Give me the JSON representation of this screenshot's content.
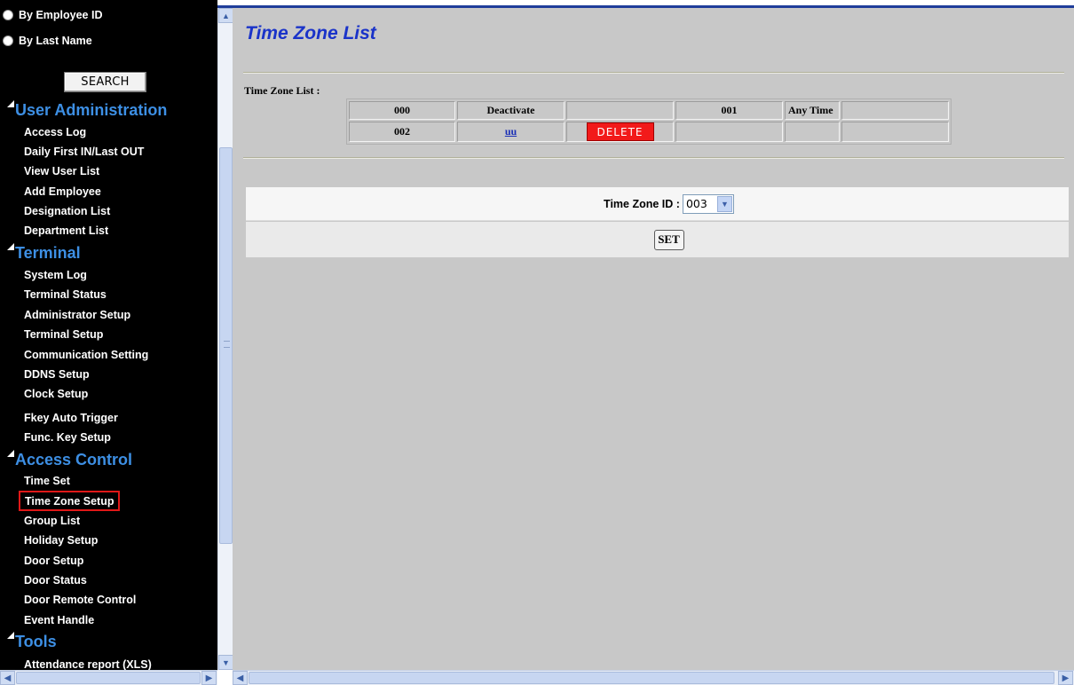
{
  "sidebar": {
    "search_options": [
      {
        "label": "By Employee ID"
      },
      {
        "label": "By Last Name"
      }
    ],
    "search_button": "SEARCH",
    "sections": [
      {
        "title": "User Administration",
        "items": [
          "Access Log",
          "Daily First IN/Last OUT",
          "View User List",
          "Add Employee",
          "Designation List",
          "Department List"
        ]
      },
      {
        "title": "Terminal",
        "items": [
          "System Log",
          "Terminal Status",
          "Administrator Setup",
          "Terminal Setup",
          "Communication Setting",
          "DDNS Setup",
          "Clock Setup",
          "Fkey Auto Trigger",
          "Func. Key Setup"
        ]
      },
      {
        "title": "Access Control",
        "items": [
          "Time Set",
          "Time Zone Setup",
          "Group List",
          "Holiday Setup",
          "Door Setup",
          "Door Status",
          "Door Remote Control",
          "Event Handle"
        ]
      },
      {
        "title": "Tools",
        "items": [
          "Attendance report (XLS)"
        ]
      }
    ],
    "selected_item": "Time Zone Setup"
  },
  "main": {
    "title": "Time Zone List",
    "list_label": "Time Zone List :",
    "table": {
      "rows": [
        [
          "000",
          "Deactivate",
          "",
          "001",
          "Any Time",
          ""
        ],
        [
          "002",
          "uu",
          "DELETE",
          "",
          "",
          ""
        ]
      ]
    },
    "form": {
      "tz_id_label": "Time Zone ID :",
      "tz_id_value": "003",
      "set_button": "SET"
    }
  },
  "colors": {
    "title_blue": "#1a33c9",
    "section_blue": "#3d8fe4",
    "delete_red": "#f21a1a",
    "selected_border": "#e01818",
    "main_background": "#c8c8c8"
  }
}
